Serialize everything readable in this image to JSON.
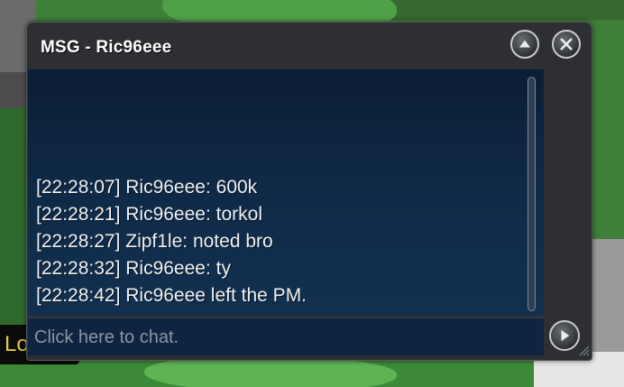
{
  "window": {
    "title": "MSG - Ric96eee"
  },
  "messages": [
    "[22:28:07] Ric96eee: 600k",
    "[22:28:21] Ric96eee: torkol",
    "[22:28:27] Zipf1le: noted bro",
    "[22:28:32] Ric96eee: ty",
    "[22:28:42] Ric96eee left the PM."
  ],
  "input": {
    "placeholder": "Click here to chat."
  },
  "background": {
    "label_fragment": "Lo"
  },
  "icons": {
    "minimize": "chevron-up-icon",
    "close": "close-icon",
    "send": "chevron-right-icon"
  }
}
